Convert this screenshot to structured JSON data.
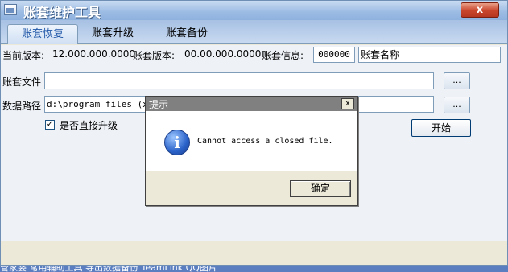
{
  "window": {
    "title": "账套维护工具",
    "close_label": "x"
  },
  "tabs": [
    {
      "label": "账套恢复",
      "active": true
    },
    {
      "label": "账套升级",
      "active": false
    },
    {
      "label": "账套备份",
      "active": false
    }
  ],
  "info": {
    "current_version_label": "当前版本:",
    "current_version_value": "12.000.000.0000",
    "account_version_label": "账套版本:",
    "account_version_value": "00.00.000.0000",
    "account_info_label": "账套信息:",
    "account_code": "000000",
    "account_name": "账套名称"
  },
  "form": {
    "account_file_label": "账套文件",
    "account_file_value": "",
    "data_path_label": "数据路径",
    "data_path_value": "d:\\program files (x86",
    "browse_label": "...",
    "direct_upgrade_label": "是否直接升级",
    "direct_upgrade_checked": true,
    "start_label": "开始"
  },
  "dialog": {
    "title": "提示",
    "close_label": "x",
    "message": "Cannot access a closed file.",
    "ok_label": "确定",
    "icon": "info-icon"
  },
  "taskbar": {
    "text": "管家婆    常用辅助工具    导出数据备份    TeamLink      QQ图片"
  },
  "colors": {
    "title_bar": "#9bbbe3",
    "panel": "#eef2f7",
    "dialog_title": "#808080",
    "accent_tab_text": "#1f56a8"
  }
}
